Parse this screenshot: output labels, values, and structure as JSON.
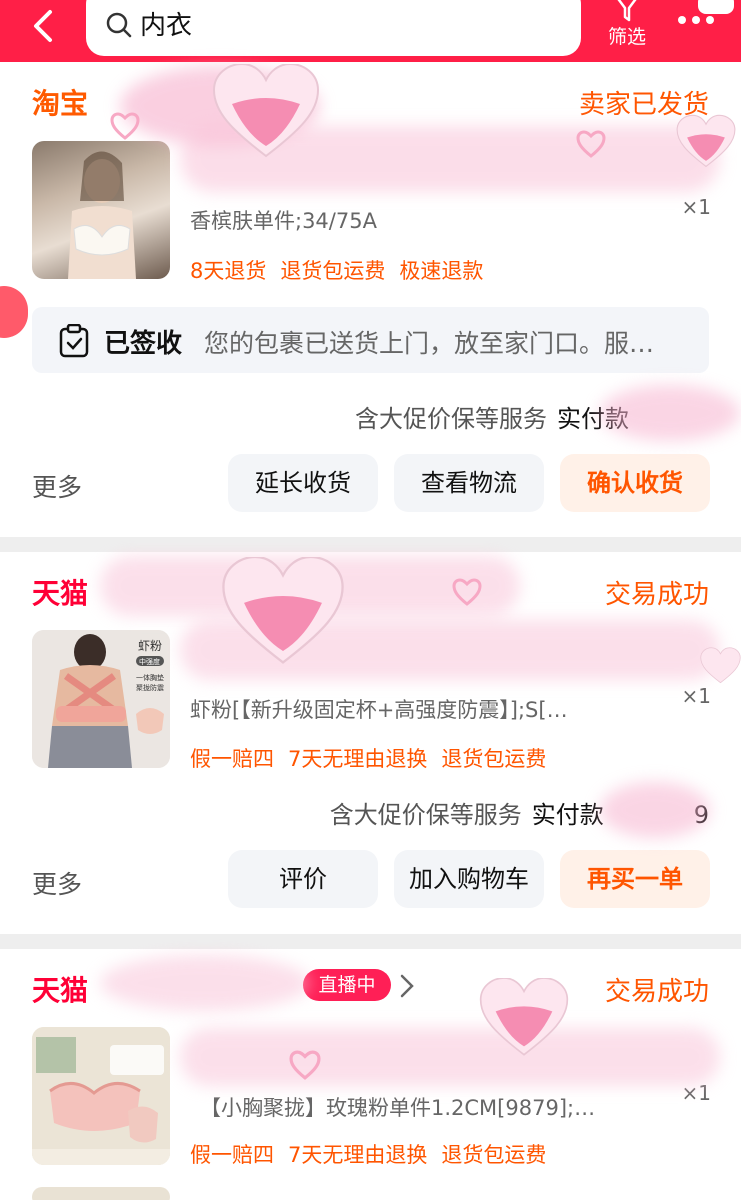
{
  "header": {
    "search_text": "内衣",
    "filter_label": "筛选"
  },
  "orders": [
    {
      "shop": "淘宝",
      "status": "卖家已发货",
      "spec": "香槟肤单件;34/75A",
      "qty": "×1",
      "tags": [
        "8天退货",
        "退货包运费",
        "极速退款"
      ],
      "logistics": {
        "status": "已签收",
        "text": "您的包裹已送货上门，放至家门口。服…"
      },
      "service": "含大促价保等服务",
      "pay_label": "实付款",
      "more": "更多",
      "buttons": [
        "延长收货",
        "查看物流",
        "确认收货"
      ]
    },
    {
      "shop": "天猫",
      "status": "交易成功",
      "spec": "虾粉[【新升级固定杯+高强度防震】];S[…",
      "qty": "×1",
      "tags": [
        "假一赔四",
        "7天无理由退换",
        "退货包运费"
      ],
      "service": "含大促价保等服务",
      "pay_label": "实付款",
      "pay_partial": "9",
      "more": "更多",
      "buttons": [
        "评价",
        "加入购物车",
        "再买一单"
      ],
      "thumb_text": {
        "title": "虾粉",
        "sub": "中强度",
        "lines": [
          "一体胸垫",
          "聚拢防震"
        ]
      }
    },
    {
      "shop": "天猫",
      "status": "交易成功",
      "live_badge": "直播中",
      "spec": "【小胸聚拢】玫瑰粉单件1.2CM[9879];…",
      "qty": "×1",
      "tags": [
        "假一赔四",
        "7天无理由退换",
        "退货包运费"
      ]
    }
  ],
  "colors": {
    "header": "#ff1f47",
    "accent": "#ff5500",
    "tmall": "#ff0036"
  }
}
